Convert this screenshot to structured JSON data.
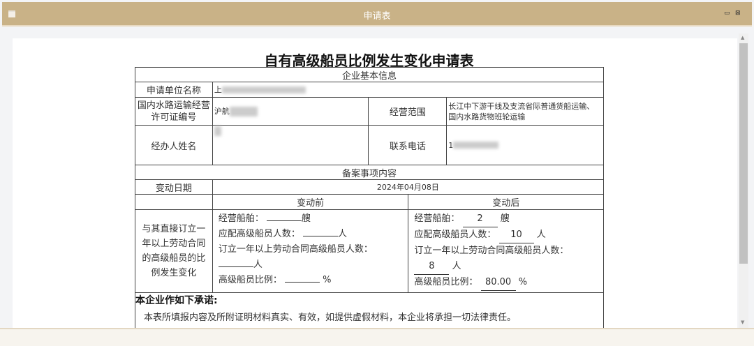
{
  "window": {
    "title": "申请表",
    "menu_icon": "menu-icon",
    "minimize_icon": "minimize-icon",
    "close_icon": "close-icon"
  },
  "form": {
    "title": "自有高级船员比例发生变化申请表",
    "section_basic": "企业基本信息",
    "applicant_label": "申请单位名称",
    "applicant_value": "上",
    "license_label": "国内水路运输经营许可证编号",
    "license_value": "沪航",
    "scope_label": "经营范围",
    "scope_value": "长江中下游干线及支流省际普通货船运输、国内水路货物班轮运输",
    "handler_label": "经办人姓名",
    "handler_value": "",
    "phone_label": "联系电话",
    "phone_value": "1",
    "section_filing": "备案事项内容",
    "date_label": "变动日期",
    "date_value": "2024年04月08日",
    "before_label": "变动前",
    "after_label": "变动后",
    "change_label": "与其直接订立一年以上劳动合同的高级船员的比例发生变化",
    "ships_label": "经营船舶：",
    "ships_unit": "艘",
    "required_label": "应配高级船员人数：",
    "person_unit": "人",
    "contract_label": "订立一年以上劳动合同高级船员人数：",
    "ratio_label": "高级船员比例：",
    "ratio_unit": "%",
    "before": {
      "ships": "",
      "required": "",
      "contract": "",
      "ratio": ""
    },
    "after": {
      "ships": "2",
      "required": "10",
      "contract": "8",
      "ratio": "80.00"
    },
    "promise_title": "本企业作如下承诺:",
    "promise_text": "本表所填报内容及所附证明材料真实、有效，如提供虚假材料，本企业将承担一切法律责任。"
  }
}
